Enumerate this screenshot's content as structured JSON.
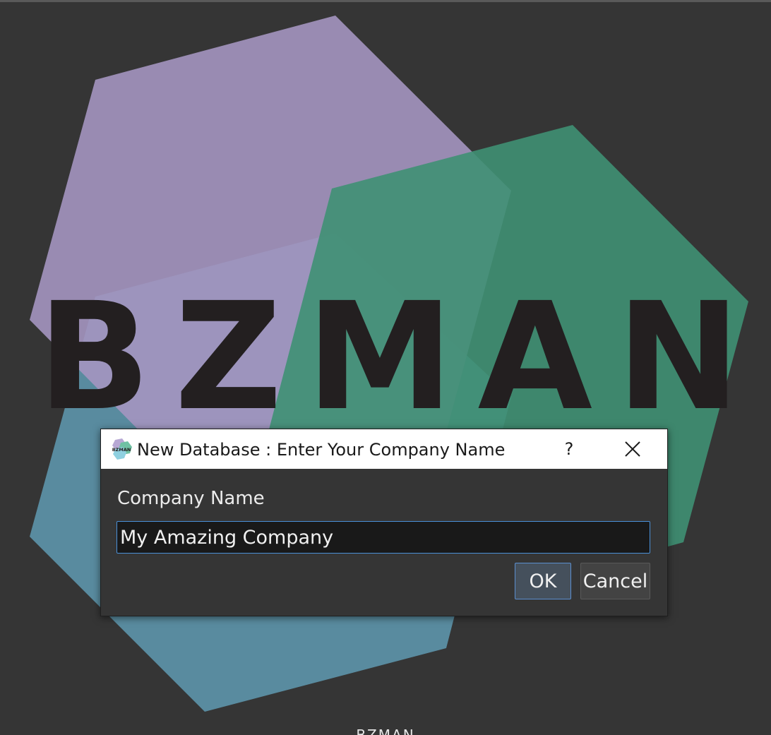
{
  "window": {
    "logo_text": "BZMAN",
    "bottom_caption": "BZMAN"
  },
  "dialog": {
    "title": "New Database : Enter Your Company Name",
    "help_label": "?",
    "close_icon": "close-icon",
    "app_icon": "bzman-app-icon",
    "app_icon_text": "BZMAN",
    "field_label": "Company Name",
    "field_value": "My Amazing Company",
    "ok_label": "OK",
    "cancel_label": "Cancel"
  },
  "colors": {
    "background": "#353535",
    "purple_hexagon": "#9c90b4",
    "green_hexagon": "#3f8f73",
    "teal_hexagon": "#5aa8a8",
    "blue_hexagon": "#5a8ea4",
    "logo_text": "#231f20",
    "accent_focus": "#4a90d9"
  }
}
